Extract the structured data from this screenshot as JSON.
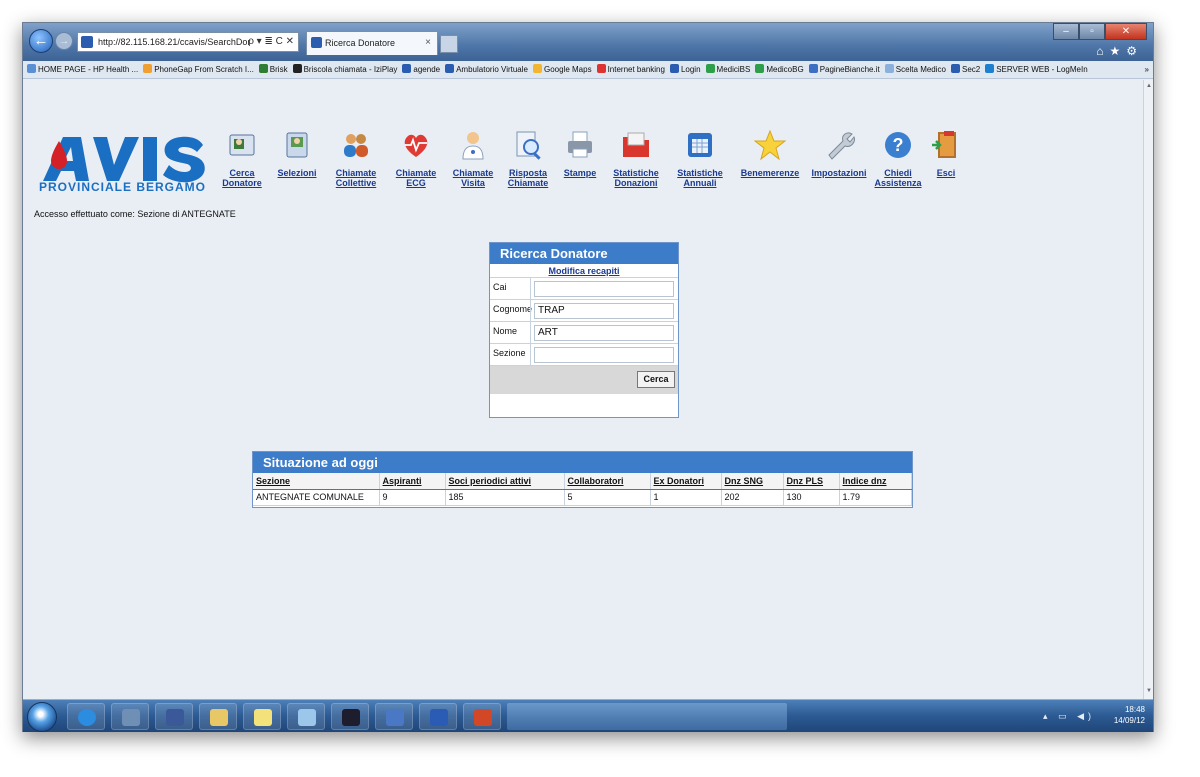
{
  "browser": {
    "address_url": "http://82.115.168.21/ccavis/SearchDor",
    "address_ctrls": "ρ ▾ ≣ C ✕",
    "tab_title": "Ricerca Donatore",
    "tab_close": "×"
  },
  "favorites": [
    "HOME PAGE - HP Health ...",
    "PhoneGap From Scratch I...",
    "Brisk",
    "Briscola chiamata - IziPlay",
    "agende",
    "Ambulatorio Virtuale",
    "Google Maps",
    "Internet banking",
    "Login",
    "MediciBS",
    "MedicoBG",
    "PagineBianche.it",
    "Scelta Medico",
    "Sec2",
    "SERVER WEB - LogMeIn"
  ],
  "favorites_more": "»",
  "logo": {
    "brand": "AVIS",
    "subtitle": "PROVINCIALE BERGAMO"
  },
  "toolbar": [
    {
      "label1": "Cerca",
      "label2": "Donatore",
      "icon": "id-card-icon"
    },
    {
      "label1": "Selezioni",
      "label2": "",
      "icon": "selection-cards-icon"
    },
    {
      "label1": "Chiamate",
      "label2": "Collettive",
      "icon": "people-group-icon"
    },
    {
      "label1": "Chiamate",
      "label2": "ECG",
      "icon": "heart-ecg-icon"
    },
    {
      "label1": "Chiamate",
      "label2": "Visita",
      "icon": "doctor-icon"
    },
    {
      "label1": "Risposta",
      "label2": "Chiamate",
      "icon": "magnifier-document-icon"
    },
    {
      "label1": "Stampe",
      "label2": "",
      "icon": "printer-icon"
    },
    {
      "label1": "Statistiche",
      "label2": "Donazioni",
      "icon": "folder-icon"
    },
    {
      "label1": "Statistiche",
      "label2": "Annuali",
      "icon": "spreadsheet-icon"
    },
    {
      "label1": "Benemerenze",
      "label2": "",
      "icon": "star-icon"
    },
    {
      "label1": "Impostazioni",
      "label2": "",
      "icon": "wrench-icon"
    },
    {
      "label1": "Chiedi",
      "label2": "Assistenza",
      "icon": "help-icon"
    },
    {
      "label1": "Esci",
      "label2": "",
      "icon": "exit-door-icon"
    }
  ],
  "access_text": "Accesso effettuato come: Sezione di ANTEGNATE",
  "search": {
    "title": "Ricerca Donatore",
    "link": "Modifica recapiti",
    "fields": [
      {
        "label": "Cai",
        "value": ""
      },
      {
        "label": "Cognome",
        "value": "TRAP"
      },
      {
        "label": "Nome",
        "value": "ART"
      },
      {
        "label": "Sezione",
        "value": ""
      }
    ],
    "button": "Cerca"
  },
  "situation": {
    "title": "Situazione ad oggi",
    "columns": [
      "Sezione",
      "Aspiranti",
      "Soci periodici attivi",
      "Collaboratori",
      "Ex Donatori",
      "Dnz SNG",
      "Dnz PLS",
      "Indice dnz"
    ],
    "rows": [
      [
        "ANTEGNATE COMUNALE",
        "9",
        "185",
        "5",
        "1",
        "202",
        "130",
        "1.79"
      ]
    ]
  },
  "taskbar": {
    "time": "18:48",
    "date": "14/09/12",
    "tray": "▴ ▭ ◀)"
  },
  "colors": {
    "panel_header": "#3c7cc9",
    "link": "#1a3a8f",
    "logo": "#1b6fc2"
  }
}
